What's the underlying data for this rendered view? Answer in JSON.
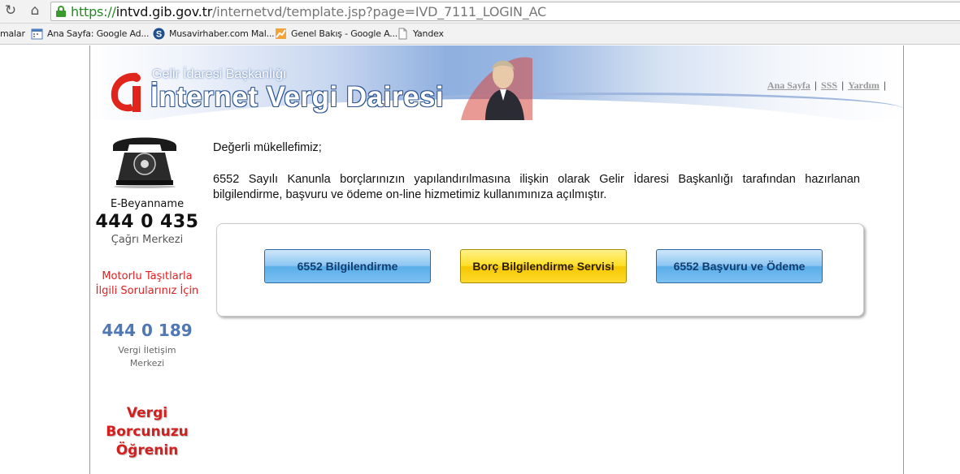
{
  "browser": {
    "url_protocol": "https://",
    "url_host": "intvd.gib.gov.tr",
    "url_path": "/internetvd/template.jsp?page=IVD_7111_LOGIN_AC",
    "bookmarks": [
      {
        "label": "malar",
        "icon": "none"
      },
      {
        "label": "Ana Sayfa: Google Ad...",
        "icon": "calendar-icon"
      },
      {
        "label": "Musavirhaber.com Mal...",
        "icon": "site-icon"
      },
      {
        "label": "Genel Bakış - Google A...",
        "icon": "analytics-icon"
      },
      {
        "label": "Yandex",
        "icon": "page-icon"
      }
    ]
  },
  "header": {
    "subtitle": "Gelir İdaresi Başkanlığı",
    "title": "İnternet Vergi Dairesi",
    "links": [
      "Ana Sayfa",
      "SSS",
      "Yardım"
    ]
  },
  "sidebar": {
    "ebeyan_title": "E-Beyanname",
    "ebeyan_number": "444 0 435",
    "ebeyan_sub": "Çağrı Merkezi",
    "motor_text": "Motorlu Taşıtlarla İlgili Sorularınız İçin",
    "vergi_number": "444 0 189",
    "vergi_sub": "Vergi İletişim Merkezi",
    "debt_link": "Vergi Borcunuzu Öğrenin"
  },
  "main": {
    "greeting": "Değerli mükellefimiz;",
    "message": "6552 Sayılı Kanunla borçlarınızın yapılandırılmasına ilişkin olarak Gelir İdaresi Başkanlığı tarafından hazırlanan bilgilendirme, başvuru ve ödeme on-line hizmetimiz kullanımınıza açılmıştır.",
    "buttons": [
      "6552 Bilgilendirme",
      "Borç Bilgilendirme Servisi",
      "6552 Başvuru ve Ödeme"
    ]
  },
  "colors": {
    "brand_blue": "#2d558f",
    "alert_red": "#e02020",
    "button_blue": "#5aaeea",
    "button_yellow": "#f5c800"
  }
}
